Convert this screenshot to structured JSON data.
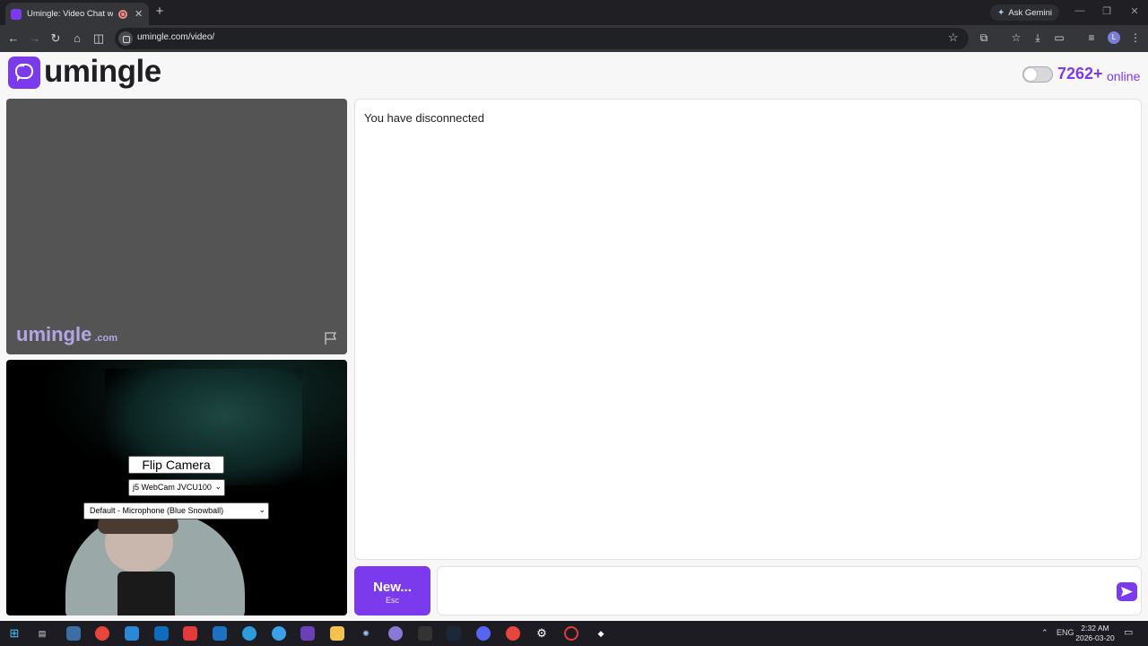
{
  "browser": {
    "tab_title": "Umingle: Video Chat with S",
    "ask_gemini": "Ask Gemini",
    "url": "umingle.com/video/",
    "profile_initial": "L"
  },
  "site": {
    "logo_text": "umingle",
    "online_count": "7262+",
    "online_label": "online",
    "accent_color": "#7c3aed",
    "watermark_main": "umingle",
    "watermark_domain": ".com"
  },
  "self_video": {
    "flip_label": "Flip Camera",
    "camera_selected": "j5 WebCam JVCU100",
    "microphone_selected": "Default - Microphone (Blue Snowball)"
  },
  "chat": {
    "status_text": "You have disconnected",
    "new_label": "New...",
    "new_shortcut": "Esc",
    "message_value": ""
  },
  "taskbar": {
    "language": "ENG",
    "time": "2:32 AM",
    "date": "2026-03-20"
  }
}
